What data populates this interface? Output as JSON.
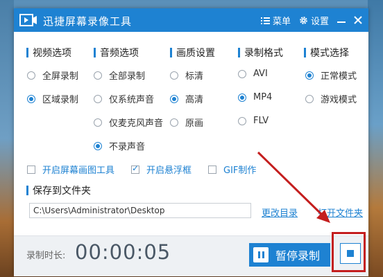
{
  "app": {
    "title": "迅捷屏幕录像工具"
  },
  "titlebar": {
    "menu_label": "菜单",
    "settings_label": "设置"
  },
  "sections": {
    "video": {
      "title": "视频选项",
      "options": [
        "全屏录制",
        "区域录制"
      ],
      "selected": "区域录制"
    },
    "audio": {
      "title": "音频选项",
      "options": [
        "全部录制",
        "仅系统声音",
        "仅麦克风声音",
        "不录声音"
      ],
      "selected": "不录声音"
    },
    "quality": {
      "title": "画质设置",
      "options": [
        "标清",
        "高清",
        "原画"
      ],
      "selected": "高清"
    },
    "format": {
      "title": "录制格式",
      "options": [
        "AVI",
        "MP4",
        "FLV"
      ],
      "selected": "MP4"
    },
    "mode": {
      "title": "模式选择",
      "options": [
        "正常模式",
        "游戏模式"
      ],
      "selected": "正常模式"
    }
  },
  "extras": [
    {
      "label": "开启屏幕画图工具",
      "checked": false
    },
    {
      "label": "开启悬浮框",
      "checked": true
    },
    {
      "label": "GIF制作",
      "checked": false
    }
  ],
  "save": {
    "title": "保存到文件夹",
    "path": "C:\\Users\\Administrator\\Desktop",
    "change_dir": "更改目录",
    "open_dir": "打开文件夹"
  },
  "bottom": {
    "duration_label": "录制时长:",
    "timer": "00:00:05",
    "pause_label": "暂停录制"
  },
  "colors": {
    "accent": "#1e82d2",
    "annotation": "#c41e1e"
  }
}
